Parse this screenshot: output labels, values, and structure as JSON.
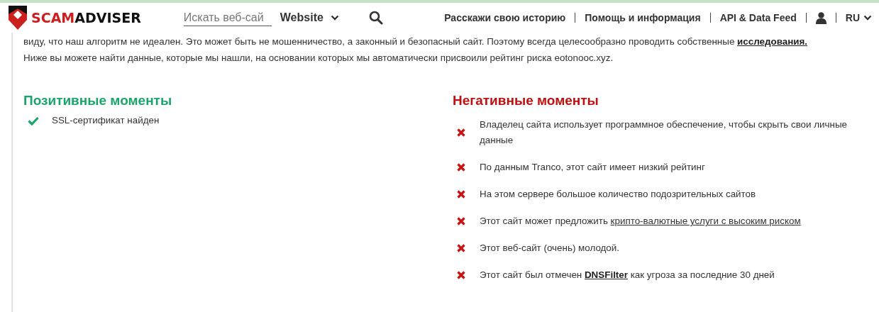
{
  "header": {
    "logo": {
      "brand_a": "SCAM",
      "brand_b": "ADVISER"
    },
    "search": {
      "placeholder": "Искать веб-сай"
    },
    "search_type": "Website",
    "nav": [
      "Расскажи свою историю",
      "Помощь и информация",
      "API & Data Feed"
    ],
    "language": "RU"
  },
  "intro": [
    {
      "parts": [
        {
          "kind": "text",
          "text": "виду, что наш алгоритм не идеален. Это может быть не мошенничество, а законный и безопасный сайт. Поэтому всегда целесообразно проводить собственные "
        },
        {
          "kind": "bold-link",
          "text": "исследования."
        }
      ]
    },
    {
      "parts": [
        {
          "kind": "text",
          "text": "Ниже вы можете найти данные, которые мы нашли, на основании которых мы автоматически присвоили рейтинг риска eotonooc.xyz."
        }
      ]
    }
  ],
  "columns": [
    {
      "kind": "positive",
      "title": "Позитивные моменты",
      "items": [
        {
          "parts": [
            {
              "kind": "text",
              "text": "SSL-сертификат найден"
            }
          ]
        }
      ]
    },
    {
      "kind": "negative",
      "title": "Негативные моменты",
      "items": [
        {
          "parts": [
            {
              "kind": "text",
              "text": "Владелец сайта использует программное обеспечение, чтобы скрыть свои личные данные"
            }
          ]
        },
        {
          "parts": [
            {
              "kind": "text",
              "text": "По данным Tranco, этот сайт имеет низкий рейтинг"
            }
          ]
        },
        {
          "parts": [
            {
              "kind": "text",
              "text": "На этом сервере большое количество подозрительных сайтов"
            }
          ]
        },
        {
          "parts": [
            {
              "kind": "text",
              "text": "Этот сайт может предложить "
            },
            {
              "kind": "link",
              "text": "крипто-валютные услуги с высоким риском"
            }
          ]
        },
        {
          "parts": [
            {
              "kind": "text",
              "text": "Этот веб-сайт (очень) молодой."
            }
          ]
        },
        {
          "parts": [
            {
              "kind": "text",
              "text": "Этот сайт был отмечен "
            },
            {
              "kind": "bold-link",
              "text": "DNSFilter"
            },
            {
              "kind": "text",
              "text": " как угроза за последние 30 дней"
            }
          ]
        }
      ]
    }
  ]
}
